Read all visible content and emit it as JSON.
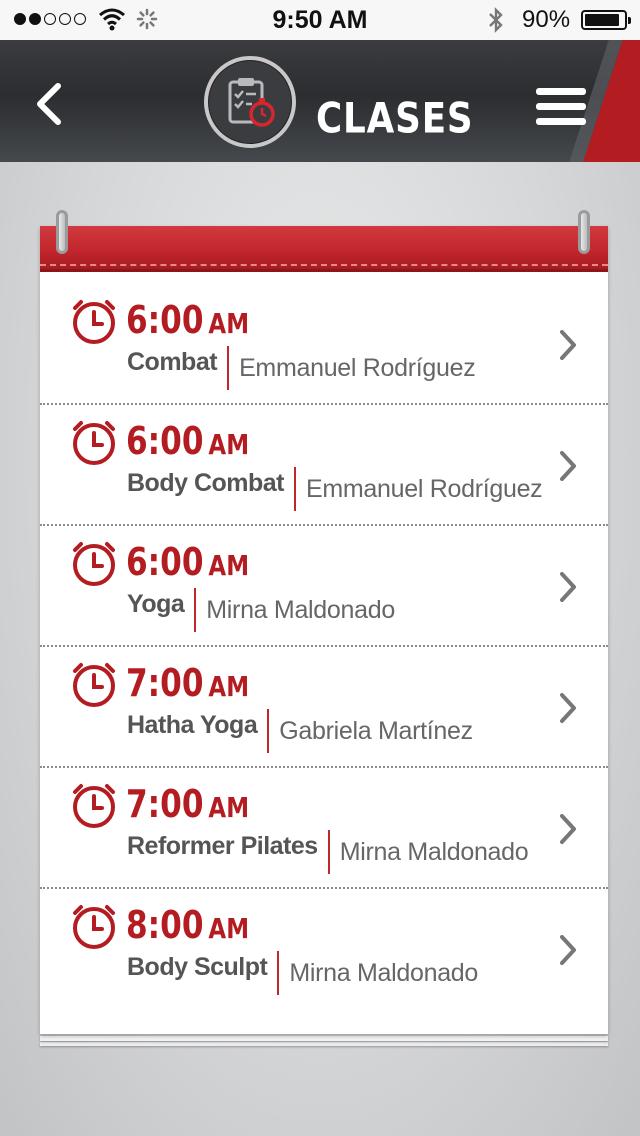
{
  "status_bar": {
    "time": "9:50 AM",
    "battery_percent": "90%",
    "battery_level": 0.9,
    "signal_bars_filled": 2,
    "signal_bars_total": 5,
    "icons": [
      "wifi-icon",
      "activity-spinner-icon",
      "bluetooth-icon",
      "battery-icon"
    ]
  },
  "header": {
    "title": "CLASES",
    "back_icon": "chevron-left-icon",
    "logo_icon": "clipboard-stopwatch-icon",
    "menu_icon": "hamburger-menu-icon"
  },
  "colors": {
    "accent": "#b31d22",
    "header_bg": "#2b2d30",
    "text_dark": "#555555",
    "text_light": "#666666"
  },
  "classes": [
    {
      "time": "6:00",
      "ampm": "AM",
      "name": "Combat",
      "instructor": "Emmanuel Rodríguez"
    },
    {
      "time": "6:00",
      "ampm": "AM",
      "name": "Body Combat",
      "instructor": "Emmanuel Rodríguez"
    },
    {
      "time": "6:00",
      "ampm": "AM",
      "name": "Yoga",
      "instructor": "Mirna Maldonado"
    },
    {
      "time": "7:00",
      "ampm": "AM",
      "name": "Hatha Yoga",
      "instructor": "Gabriela Martínez"
    },
    {
      "time": "7:00",
      "ampm": "AM",
      "name": "Reformer Pilates",
      "instructor": "Mirna Maldonado"
    },
    {
      "time": "8:00",
      "ampm": "AM",
      "name": "Body Sculpt",
      "instructor": "Mirna Maldonado"
    }
  ]
}
